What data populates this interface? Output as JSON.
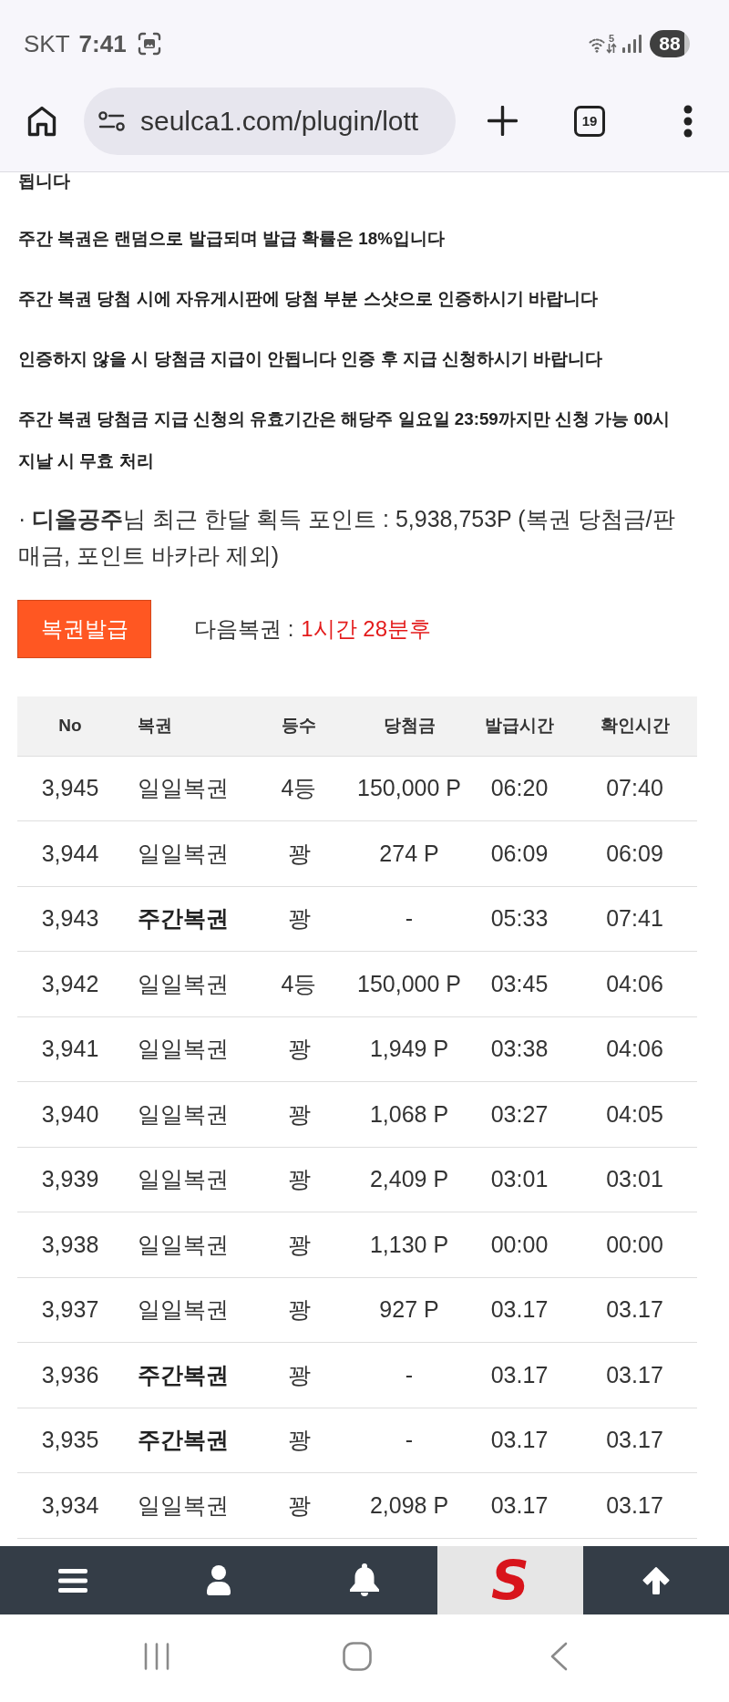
{
  "status_bar": {
    "carrier": "SKT",
    "time": "7:41",
    "network_label": "5",
    "battery": "88"
  },
  "browser": {
    "url": "seulca1.com/plugin/lott",
    "tab_count": "19"
  },
  "notices": [
    "됩니다",
    "주간 복권은 랜덤으로 발급되며 발급 확률은 18%입니다",
    "주간 복권 당첨 시에 자유게시판에 당첨 부분 스샷으로 인증하시기 바랍니다",
    "인증하지 않을 시 당첨금 지급이 안됩니다 인증 후 지급 신청하시기 바랍니다",
    "주간 복권 당첨금 지급 신청의 유효기간은 해당주 일요일 23:59까지만 신청 가능 00시 지날 시 무효 처리"
  ],
  "points_summary": "· **디올공주**님 최근 한달 획득 포인트 : 5,938,753P (복권 당첨금/판매금, 포인트 바카라 제외)",
  "issue_button": {
    "label": "복권발급"
  },
  "next_ticket": {
    "label": "다음복권 :",
    "remaining": "1시간 28분후"
  },
  "table": {
    "columns": [
      "No",
      "복권",
      "등수",
      "당첨금",
      "발급시간",
      "확인시간"
    ],
    "rows": [
      {
        "kind": "daily",
        "cells": [
          "3,945",
          "일일복권",
          "4등",
          "150,000 P",
          "06:20",
          "07:40"
        ]
      },
      {
        "kind": "daily",
        "cells": [
          "3,944",
          "일일복권",
          "꽝",
          "274 P",
          "06:09",
          "06:09"
        ]
      },
      {
        "kind": "weekly",
        "cells": [
          "3,943",
          "주간복권",
          "꽝",
          "-",
          "05:33",
          "07:41"
        ]
      },
      {
        "kind": "daily",
        "cells": [
          "3,942",
          "일일복권",
          "4등",
          "150,000 P",
          "03:45",
          "04:06"
        ]
      },
      {
        "kind": "daily",
        "cells": [
          "3,941",
          "일일복권",
          "꽝",
          "1,949 P",
          "03:38",
          "04:06"
        ]
      },
      {
        "kind": "daily",
        "cells": [
          "3,940",
          "일일복권",
          "꽝",
          "1,068 P",
          "03:27",
          "04:05"
        ]
      },
      {
        "kind": "daily",
        "cells": [
          "3,939",
          "일일복권",
          "꽝",
          "2,409 P",
          "03:01",
          "03:01"
        ]
      },
      {
        "kind": "daily",
        "cells": [
          "3,938",
          "일일복권",
          "꽝",
          "1,130 P",
          "00:00",
          "00:00"
        ]
      },
      {
        "kind": "daily",
        "cells": [
          "3,937",
          "일일복권",
          "꽝",
          "927 P",
          "03.17",
          "03.17"
        ]
      },
      {
        "kind": "weekly",
        "cells": [
          "3,936",
          "주간복권",
          "꽝",
          "-",
          "03.17",
          "03.17"
        ]
      },
      {
        "kind": "weekly",
        "cells": [
          "3,935",
          "주간복권",
          "꽝",
          "-",
          "03.17",
          "03.17"
        ]
      },
      {
        "kind": "daily",
        "cells": [
          "3,934",
          "일일복권",
          "꽝",
          "2,098 P",
          "03.17",
          "03.17"
        ]
      }
    ]
  },
  "bottom_nav": [
    {
      "kind": "menu"
    },
    {
      "kind": "profile"
    },
    {
      "kind": "notifications"
    },
    {
      "kind": "logo",
      "text": "S"
    },
    {
      "kind": "top"
    }
  ]
}
